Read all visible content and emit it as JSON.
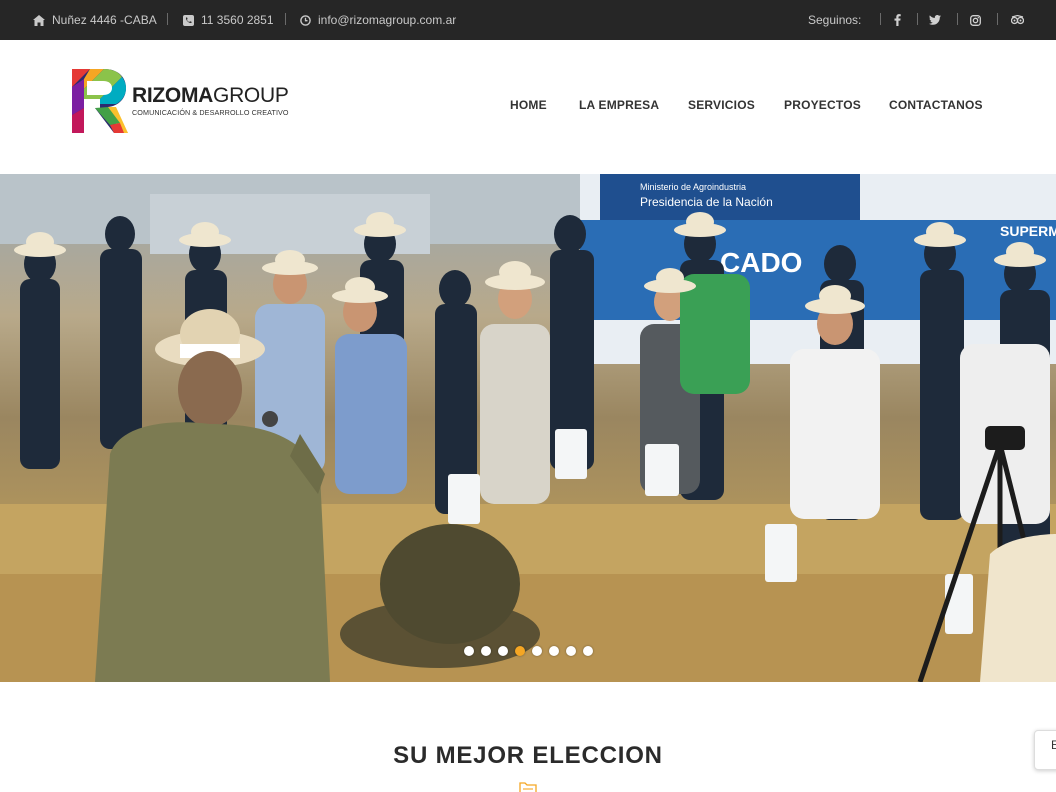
{
  "topbar": {
    "address": "Nuñez 4446 -CABA",
    "phone": "11 3560 2851",
    "email": "info@rizomagroup.com.ar",
    "follow_label": "Seguinos:",
    "social": [
      "facebook-icon",
      "twitter-icon",
      "instagram-icon",
      "tripadvisor-icon"
    ]
  },
  "brand": {
    "name_bold": "RIZOMA",
    "name_light": "GROUP",
    "tagline": "COMUNICACIÓN & DESARROLLO CREATIVO"
  },
  "nav": {
    "items": [
      "HOME",
      "LA EMPRESA",
      "SERVICIOS",
      "PROYECTOS",
      "CONTACTANOS"
    ]
  },
  "hero": {
    "banner_text_1": "Ministerio de Agroindustria",
    "banner_text_2": "Presidencia de la Nación",
    "banner_text_3": "CADO",
    "banner_text_4": "SUPERM",
    "slides_count": 8,
    "active_slide": 4
  },
  "section": {
    "title": "SU MEJOR ELECCION"
  },
  "side_tab": {
    "label": "E"
  },
  "colors": {
    "topbar_bg": "#262626",
    "accent": "#f5a623",
    "text_dark": "#2b2b2b"
  }
}
